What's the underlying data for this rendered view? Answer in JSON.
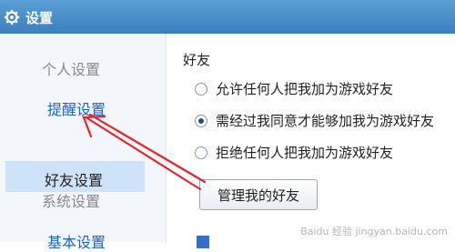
{
  "window": {
    "title": "设置",
    "icon": "gear-icon"
  },
  "sidebar": {
    "groups": [
      {
        "label": "个人设置"
      },
      {
        "label": "系统设置"
      }
    ],
    "items": [
      {
        "label": "提醒设置"
      },
      {
        "label": "好友设置"
      },
      {
        "label": "基本设置"
      }
    ]
  },
  "main": {
    "section_title": "好友",
    "options": [
      {
        "label": "允许任何人把我加为游戏好友",
        "selected": false
      },
      {
        "label": "需经过我同意才能够加我为游戏好友",
        "selected": true
      },
      {
        "label": "拒绝任何人把我加为游戏好友",
        "selected": false
      }
    ],
    "manage_button": "管理我的好友"
  },
  "annotation": {
    "arrow_color": "#e8242a"
  },
  "watermark": "Baidu 经验  jingyan.baidu.com"
}
